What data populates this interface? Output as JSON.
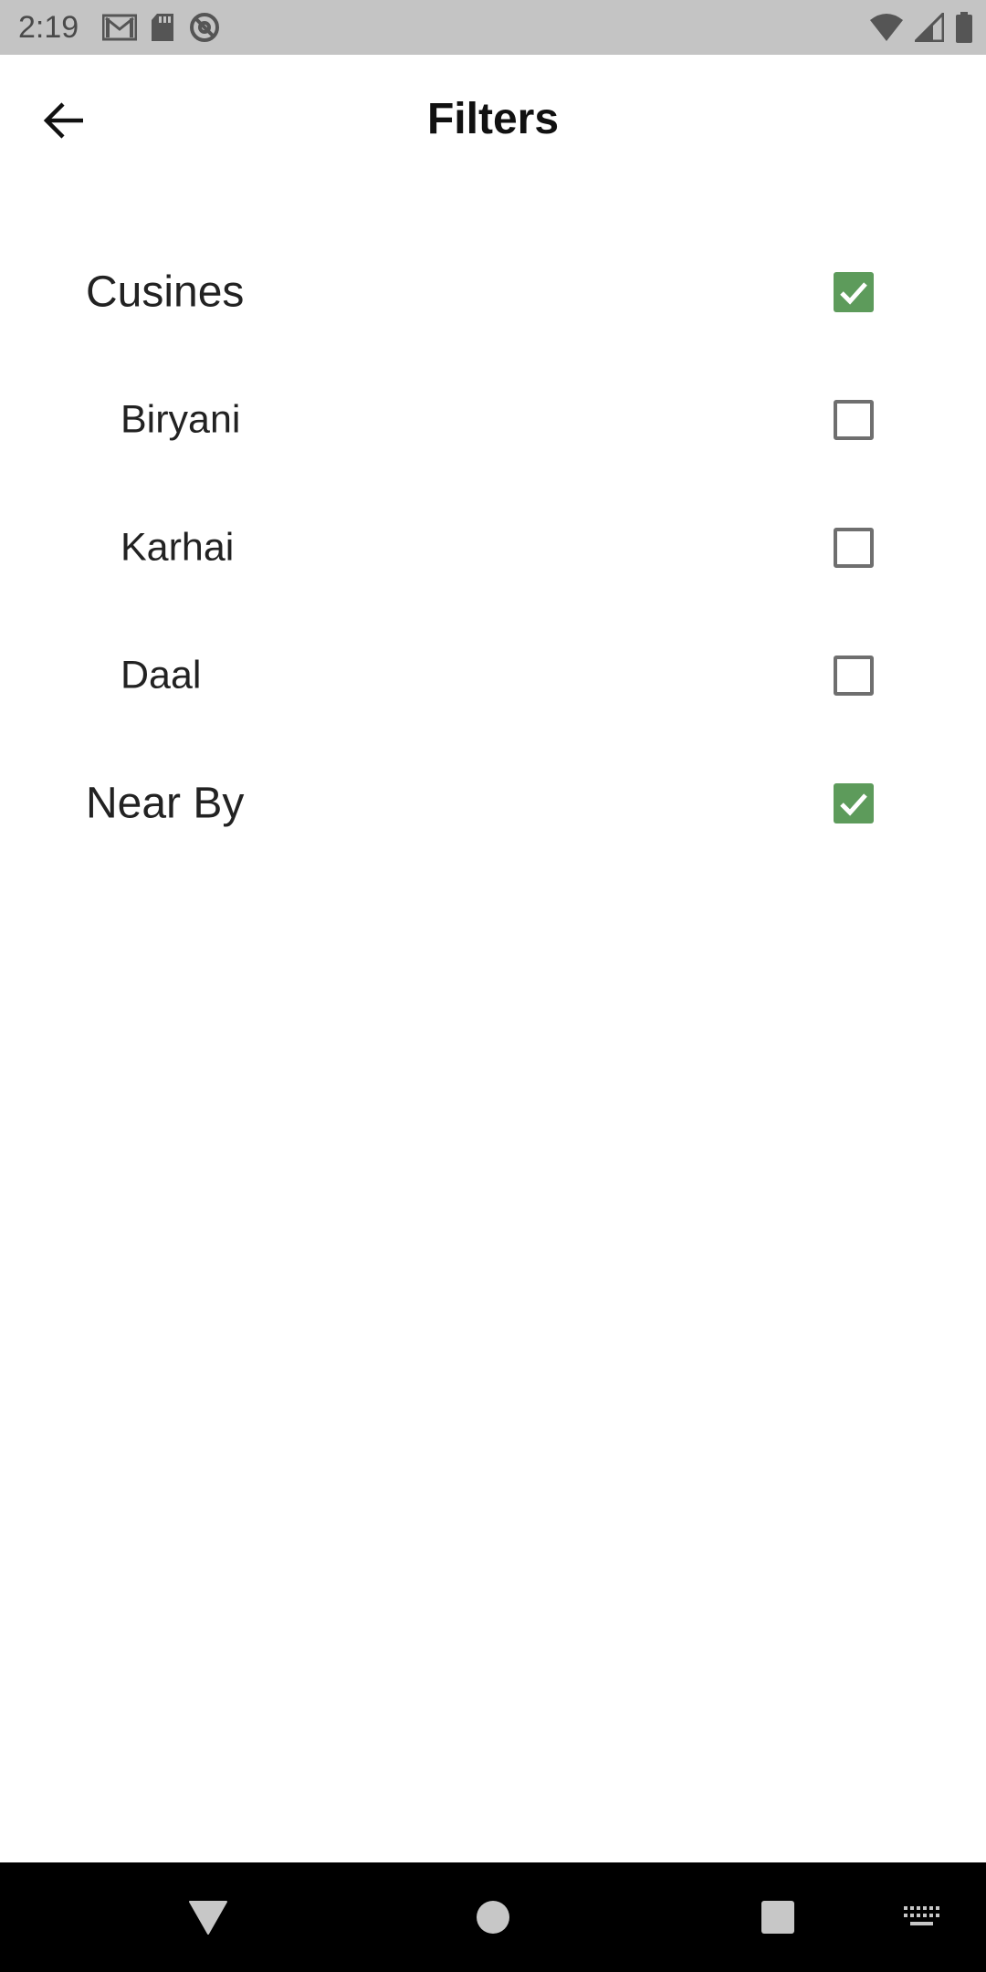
{
  "status_bar": {
    "time": "2:19",
    "left_icons": [
      "gmail-icon",
      "sd-card-icon",
      "data-saver-icon"
    ],
    "right_icons": [
      "wifi-icon",
      "cellular-signal-icon",
      "battery-icon"
    ]
  },
  "app_bar": {
    "title": "Filters",
    "back_icon": "arrow-back-icon"
  },
  "filters": [
    {
      "label": "Cusines",
      "level": "parent",
      "checked": true
    },
    {
      "label": "Biryani",
      "level": "child",
      "checked": false
    },
    {
      "label": "Karhai",
      "level": "child",
      "checked": false
    },
    {
      "label": "Daal",
      "level": "child",
      "checked": false
    },
    {
      "label": "Near By",
      "level": "parent",
      "checked": true
    }
  ],
  "colors": {
    "checkbox_checked": "#5d9b5b",
    "checkbox_border": "#6f6f6f",
    "status_bar": "#c4c4c4",
    "nav_bar": "#000000"
  },
  "nav_bar": {
    "buttons": [
      "back-triangle-icon",
      "home-circle-icon",
      "recents-square-icon",
      "keyboard-icon"
    ]
  }
}
